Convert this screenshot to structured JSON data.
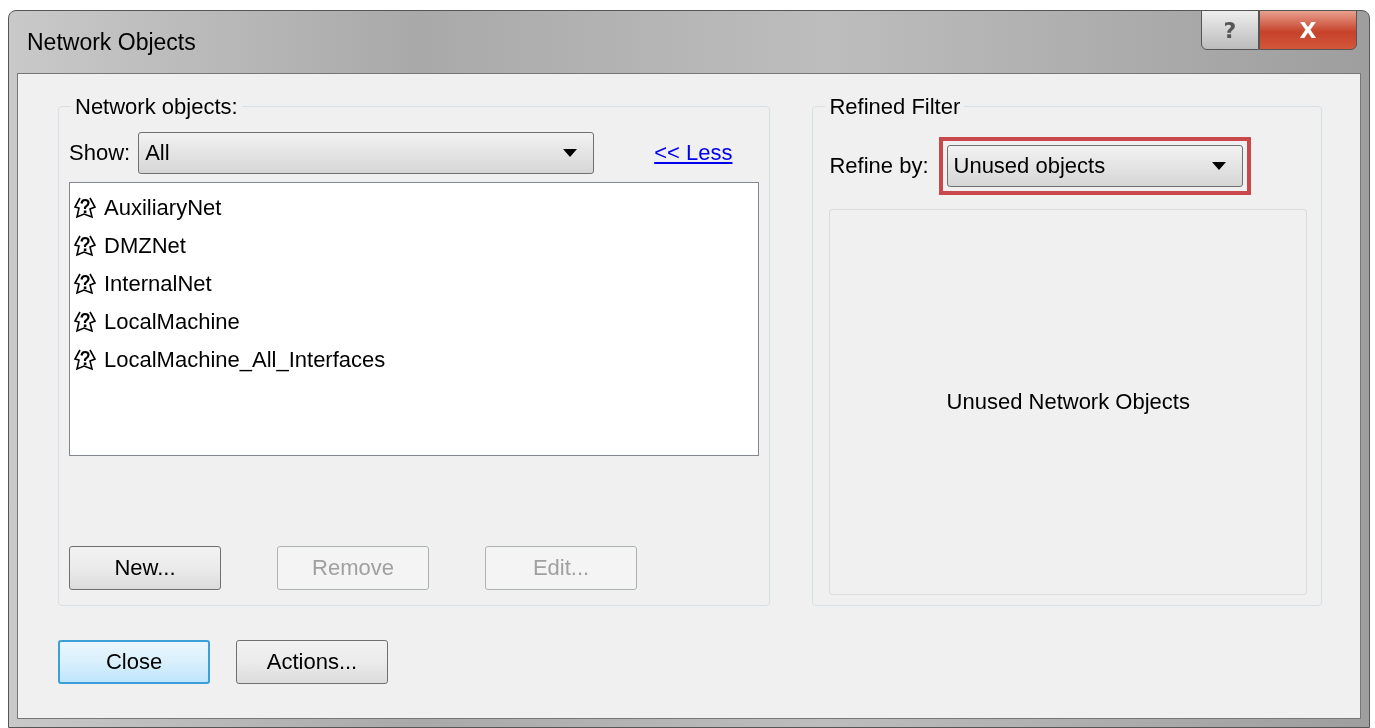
{
  "window": {
    "title": "Network Objects",
    "help_button": "?",
    "close_button": "X"
  },
  "network_objects": {
    "title": "Network objects:",
    "show_label": "Show:",
    "show_value": "All",
    "less_link": "<< Less",
    "items": [
      {
        "label": "AuxiliaryNet"
      },
      {
        "label": "DMZNet"
      },
      {
        "label": "InternalNet"
      },
      {
        "label": "LocalMachine"
      },
      {
        "label": "LocalMachine_All_Interfaces"
      }
    ],
    "buttons": [
      {
        "label": "New...",
        "disabled": false
      },
      {
        "label": "Remove",
        "disabled": true
      },
      {
        "label": "Edit...",
        "disabled": true
      }
    ]
  },
  "refined_filter": {
    "title": "Refined Filter",
    "refine_label": "Refine by:",
    "refine_value": "Unused objects",
    "highlighted": true,
    "panel_text": "Unused Network Objects"
  },
  "footer_buttons": [
    {
      "label": "Close",
      "default": true
    },
    {
      "label": "Actions...",
      "default": false
    }
  ]
}
